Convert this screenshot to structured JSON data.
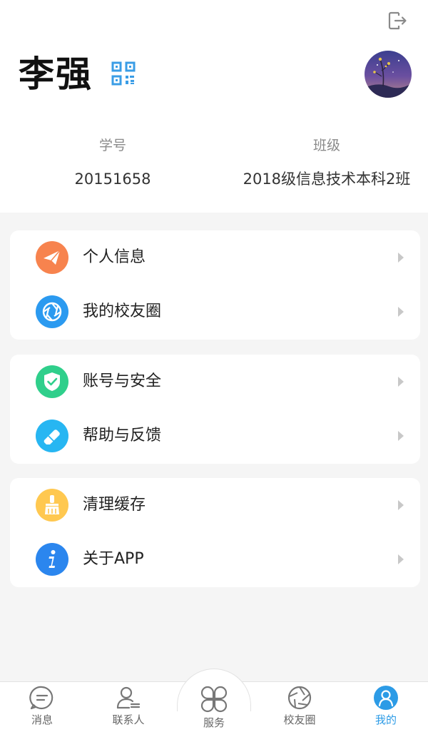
{
  "profile": {
    "name": "李强",
    "student_id_label": "学号",
    "student_id": "20151658",
    "class_label": "班级",
    "class_name": "2018级信息技术本科2班"
  },
  "menu": [
    {
      "label": "个人信息",
      "icon": "paper-plane-icon",
      "color": "#f7834e"
    },
    {
      "label": "我的校友圈",
      "icon": "aperture-icon",
      "color": "#2b9af0"
    },
    {
      "label": "账号与安全",
      "icon": "shield-check-icon",
      "color": "#2fcf8b"
    },
    {
      "label": "帮助与反馈",
      "icon": "eraser-icon",
      "color": "#27b6f2"
    },
    {
      "label": "清理缓存",
      "icon": "broom-icon",
      "color": "#ffc850"
    },
    {
      "label": "关于APP",
      "icon": "info-icon",
      "color": "#2b86ee"
    }
  ],
  "tabs": [
    {
      "label": "消息",
      "icon": "message-icon"
    },
    {
      "label": "联系人",
      "icon": "contacts-icon"
    },
    {
      "label": "服务",
      "icon": "services-grid-icon"
    },
    {
      "label": "校友圈",
      "icon": "aperture-icon"
    },
    {
      "label": "我的",
      "icon": "user-icon",
      "active": true
    }
  ],
  "colors": {
    "accent": "#2c9be6",
    "background": "#f5f5f5",
    "tab_inactive": "#666666"
  }
}
